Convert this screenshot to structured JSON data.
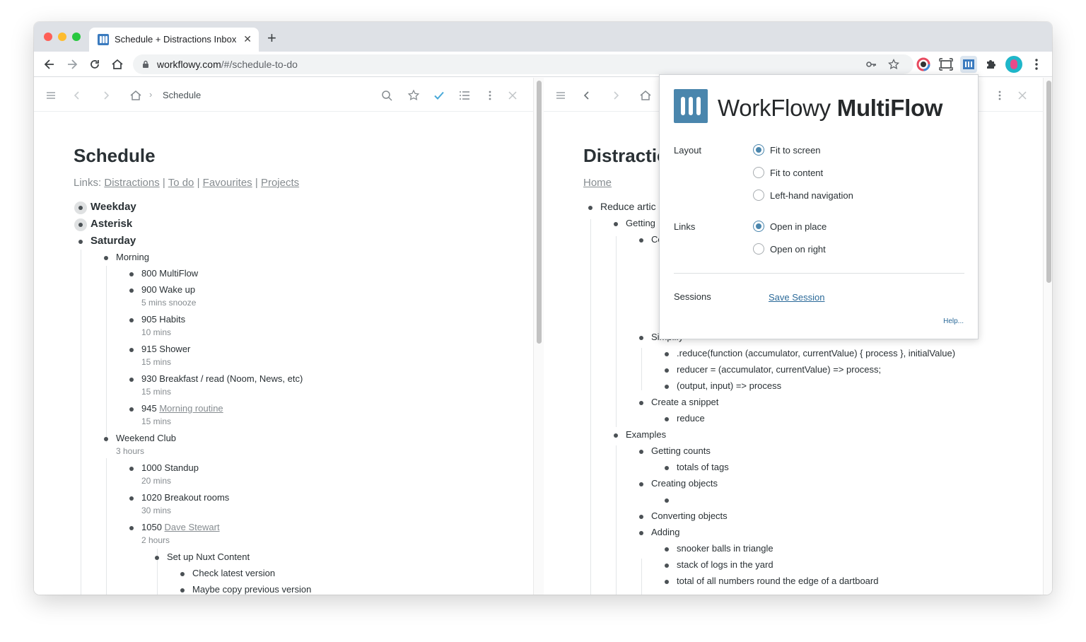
{
  "browser": {
    "tab_title": "Schedule + Distractions Inbox",
    "tab_close": "✕",
    "new_tab": "+",
    "url_host": "workflowy.com",
    "url_path": "/#/schedule-to-do",
    "extensions": [
      "color-picker-icon",
      "screenshot-icon",
      "multiflow-extension-icon",
      "puzzle-icon",
      "profile-avatar",
      "more-menu-icon"
    ]
  },
  "left_pane": {
    "breadcrumb": "Schedule",
    "title": "Schedule",
    "links_prefix": "Links:",
    "links": [
      "Distractions",
      "To do",
      "Favourites",
      "Projects"
    ],
    "sep": "|",
    "nodes": {
      "weekday": "Weekday",
      "asterisk": "Asterisk",
      "saturday": "Saturday",
      "morning": "Morning",
      "n800": "800 MultiFlow",
      "n900": "900 Wake up",
      "n900_note": "5 mins snooze",
      "n905": "905 Habits",
      "n905_note": "10 mins",
      "n915": "915 Shower",
      "n915_note": "15 mins",
      "n930": "930 Breakfast / read (Noom, News, etc)",
      "n930_note": "15 mins",
      "n945_prefix": "945",
      "n945_link": "Morning routine",
      "n945_note": "15 mins",
      "weekend_club": "Weekend Club",
      "weekend_club_note": "3 hours",
      "n1000": "1000 Standup",
      "n1000_note": "20 mins",
      "n1020": "1020 Breakout rooms",
      "n1020_note": "30 mins",
      "n1050_prefix": "1050",
      "n1050_link": "Dave Stewart",
      "n1050_note": "2 hours",
      "nuxt": "Set up Nuxt Content",
      "check": "Check latest version",
      "maybe": "Maybe copy previous version"
    }
  },
  "right_pane": {
    "title": "Distractio",
    "home_link": "Home",
    "nodes": {
      "reduce": "Reduce artic",
      "getting": "Getting",
      "co": "Co",
      "simplify": "Simplify",
      "reduce_fn": ".reduce(function (accumulator, currentValue) { process }, initialValue)",
      "reducer": "reducer = (accumulator, currentValue) => process;",
      "output_input": "(output, input) => process",
      "snippet": "Create a snippet",
      "reduce_word": "reduce",
      "examples": "Examples",
      "getting_counts": "Getting counts",
      "totals": "totals of tags",
      "creating": "Creating objects",
      "converting": "Converting objects",
      "adding": "Adding",
      "snooker": "snooker balls in triangle",
      "logs": "stack of logs in the yard",
      "dartboard": "total of all numbers round the edge of a dartboard"
    }
  },
  "popup": {
    "title_light": "WorkFlowy ",
    "title_bold": "MultiFlow",
    "layout_label": "Layout",
    "layout_options": [
      "Fit to screen",
      "Fit to content",
      "Left-hand navigation"
    ],
    "layout_selected": "Fit to screen",
    "links_label": "Links",
    "links_options": [
      "Open in place",
      "Open on right"
    ],
    "links_selected": "Open in place",
    "sessions_label": "Sessions",
    "save_session": "Save Session",
    "help": "Help..."
  },
  "colors": {
    "accent": "#4a86ad",
    "check": "#49a9d8",
    "link": "#2b6a99"
  }
}
